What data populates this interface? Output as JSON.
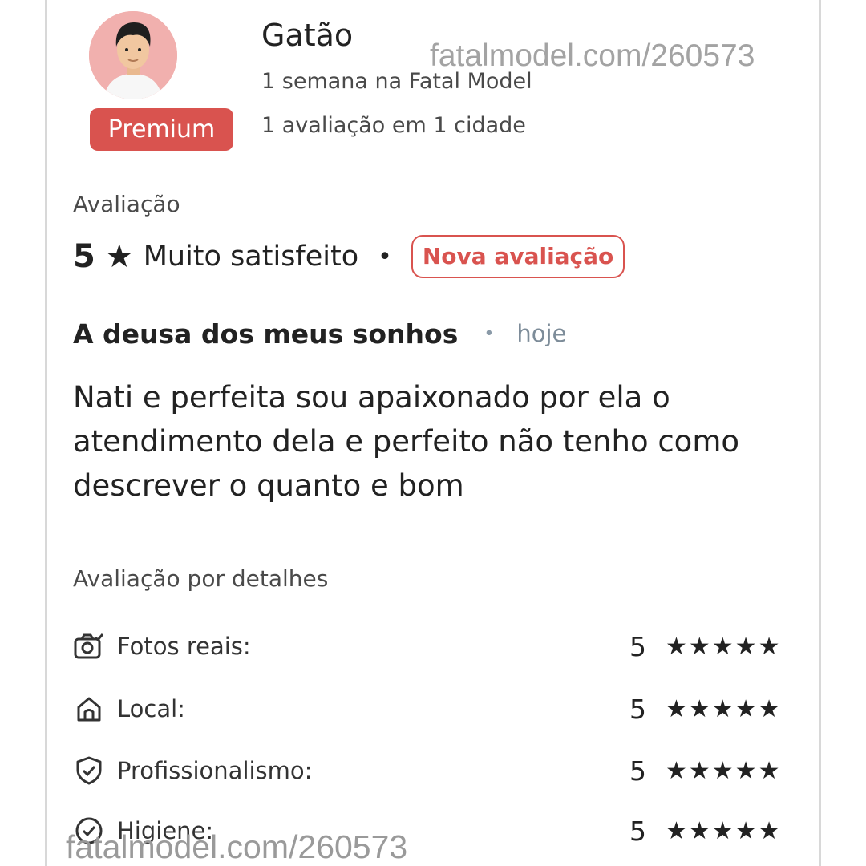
{
  "profile": {
    "name": "Gatão",
    "since": "1 semana na Fatal Model",
    "reviews_count": "1 avaliação em 1 cidade",
    "badge": "Premium",
    "avatar": "male-avatar-icon"
  },
  "watermark": "fatalmodel.com/260573",
  "rating": {
    "section_title": "Avaliação",
    "score": "5",
    "star": "★",
    "label": "Muito satisfeito",
    "separator": "•",
    "badge": "Nova avaliação"
  },
  "review": {
    "title": "A deusa dos meus sonhos",
    "separator": "•",
    "time": "hoje",
    "body": "Nati e perfeita sou apaixonado por ela o atendimento dela e perfeito não tenho como descrever o quanto e bom"
  },
  "details": {
    "section_title": "Avaliação por detalhes",
    "items": [
      {
        "icon": "camera-icon",
        "label": "Fotos reais:",
        "score": "5",
        "stars": "★★★★★",
        "rating": 5
      },
      {
        "icon": "home-icon",
        "label": "Local:",
        "score": "5",
        "stars": "★★★★★",
        "rating": 5
      },
      {
        "icon": "shield-check-icon",
        "label": "Profissionalismo:",
        "score": "5",
        "stars": "★★★★★",
        "rating": 5
      },
      {
        "icon": "check-circle-icon",
        "label": "Higiene:",
        "score": "5",
        "stars": "★★★★★",
        "rating": 5
      }
    ]
  },
  "colors": {
    "accent": "#d9534f",
    "text": "#222222",
    "muted": "#7d8c99",
    "watermark": "#a3a3a3"
  }
}
